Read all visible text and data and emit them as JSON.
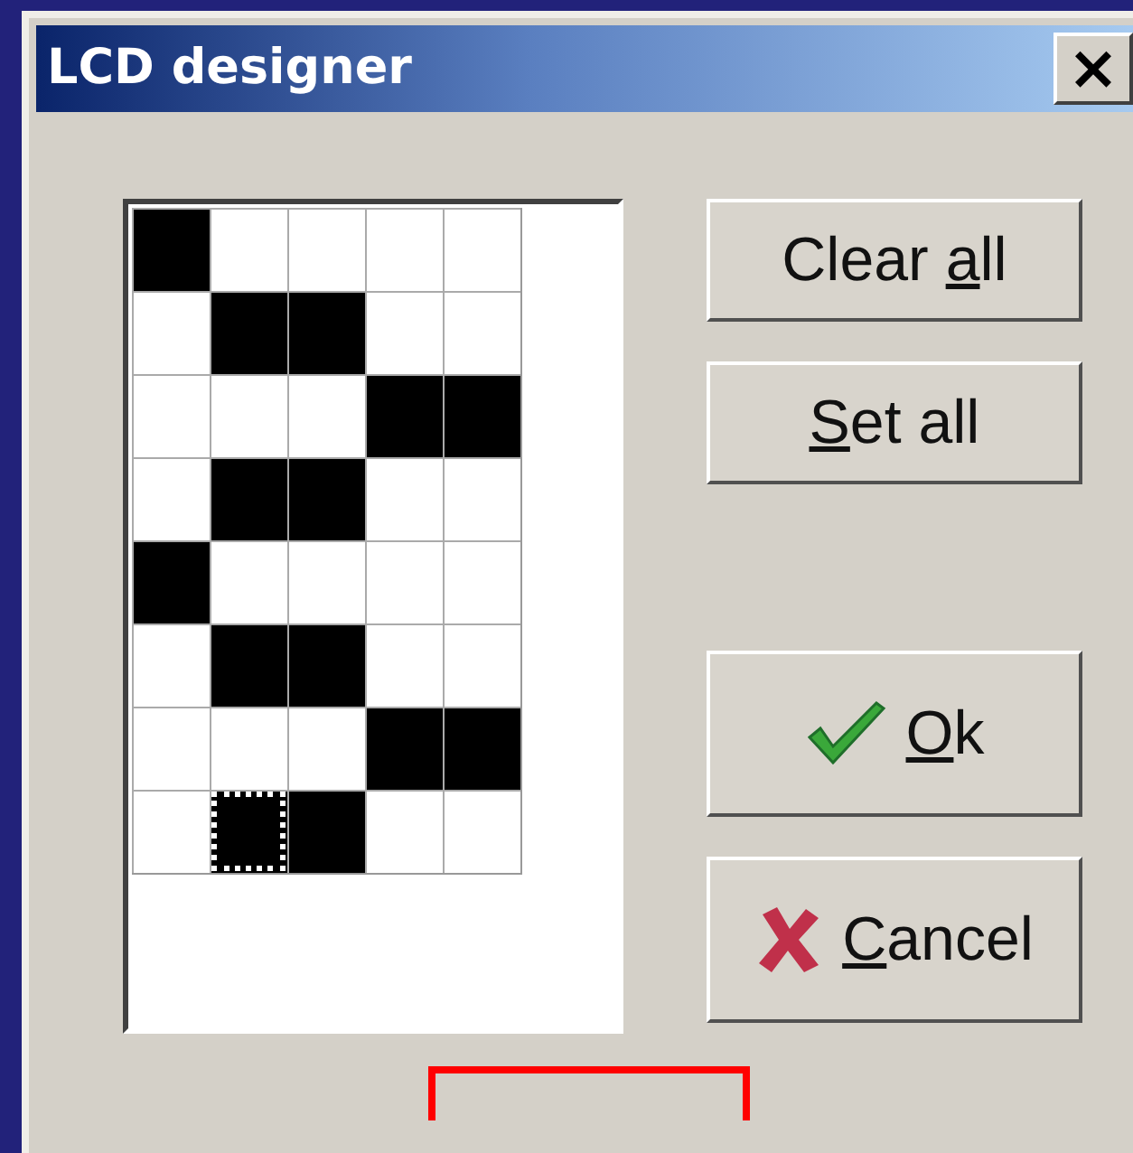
{
  "window": {
    "title": "LCD designer",
    "close": "×"
  },
  "grid": {
    "rows": [
      {
        "cells": [
          {
            "on": true,
            "focused": false
          },
          {
            "on": false,
            "focused": false
          },
          {
            "on": false,
            "focused": false
          },
          {
            "on": false,
            "focused": false
          },
          {
            "on": false,
            "focused": false
          }
        ]
      },
      {
        "cells": [
          {
            "on": false,
            "focused": false
          },
          {
            "on": true,
            "focused": false
          },
          {
            "on": true,
            "focused": false
          },
          {
            "on": false,
            "focused": false
          },
          {
            "on": false,
            "focused": false
          }
        ]
      },
      {
        "cells": [
          {
            "on": false,
            "focused": false
          },
          {
            "on": false,
            "focused": false
          },
          {
            "on": false,
            "focused": false
          },
          {
            "on": true,
            "focused": false
          },
          {
            "on": true,
            "focused": false
          }
        ]
      },
      {
        "cells": [
          {
            "on": false,
            "focused": false
          },
          {
            "on": true,
            "focused": false
          },
          {
            "on": true,
            "focused": false
          },
          {
            "on": false,
            "focused": false
          },
          {
            "on": false,
            "focused": false
          }
        ]
      },
      {
        "cells": [
          {
            "on": true,
            "focused": false
          },
          {
            "on": false,
            "focused": false
          },
          {
            "on": false,
            "focused": false
          },
          {
            "on": false,
            "focused": false
          },
          {
            "on": false,
            "focused": false
          }
        ]
      },
      {
        "cells": [
          {
            "on": false,
            "focused": false
          },
          {
            "on": true,
            "focused": false
          },
          {
            "on": true,
            "focused": false
          },
          {
            "on": false,
            "focused": false
          },
          {
            "on": false,
            "focused": false
          }
        ]
      },
      {
        "cells": [
          {
            "on": false,
            "focused": false
          },
          {
            "on": false,
            "focused": false
          },
          {
            "on": false,
            "focused": false
          },
          {
            "on": true,
            "focused": false
          },
          {
            "on": true,
            "focused": false
          }
        ]
      },
      {
        "cells": [
          {
            "on": false,
            "focused": false
          },
          {
            "on": true,
            "focused": true
          },
          {
            "on": true,
            "focused": false
          },
          {
            "on": false,
            "focused": false
          },
          {
            "on": false,
            "focused": false
          }
        ]
      }
    ]
  },
  "buttons": [
    {
      "kind": "plain",
      "before": "Clear ",
      "mnemonic": "a",
      "after": "ll"
    },
    {
      "kind": "plain",
      "mnemonic": "S",
      "after": "et all"
    },
    {
      "kind": "ok",
      "mnemonic": "O",
      "after": "k"
    },
    {
      "kind": "cancel",
      "mnemonic": "C",
      "after": "ancel"
    }
  ],
  "highlight": {
    "kind": "frame"
  }
}
